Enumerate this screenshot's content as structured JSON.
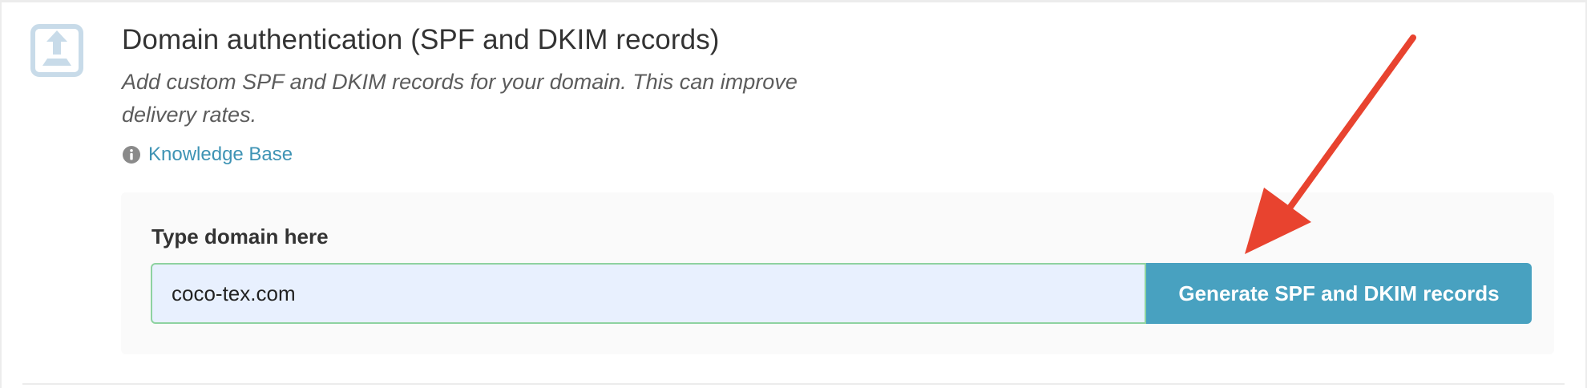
{
  "section": {
    "title": "Domain authentication (SPF and DKIM records)",
    "description": "Add custom SPF and DKIM records for your domain. This can improve delivery rates.",
    "icon": "upload-icon",
    "knowledge_base": {
      "label": "Knowledge Base",
      "icon": "info-circle-icon"
    }
  },
  "form": {
    "label": "Type domain here",
    "input_value": "coco-tex.com",
    "button_label": "Generate SPF and DKIM records"
  },
  "annotation": {
    "icon": "red-arrow-icon"
  },
  "colors": {
    "accent": "#48a1c0",
    "link": "#3e93b4",
    "input_background": "#e8f0fe",
    "input_border": "#8ed2a0",
    "arrow": "#e8432f",
    "icon": "#c8dbe9"
  }
}
